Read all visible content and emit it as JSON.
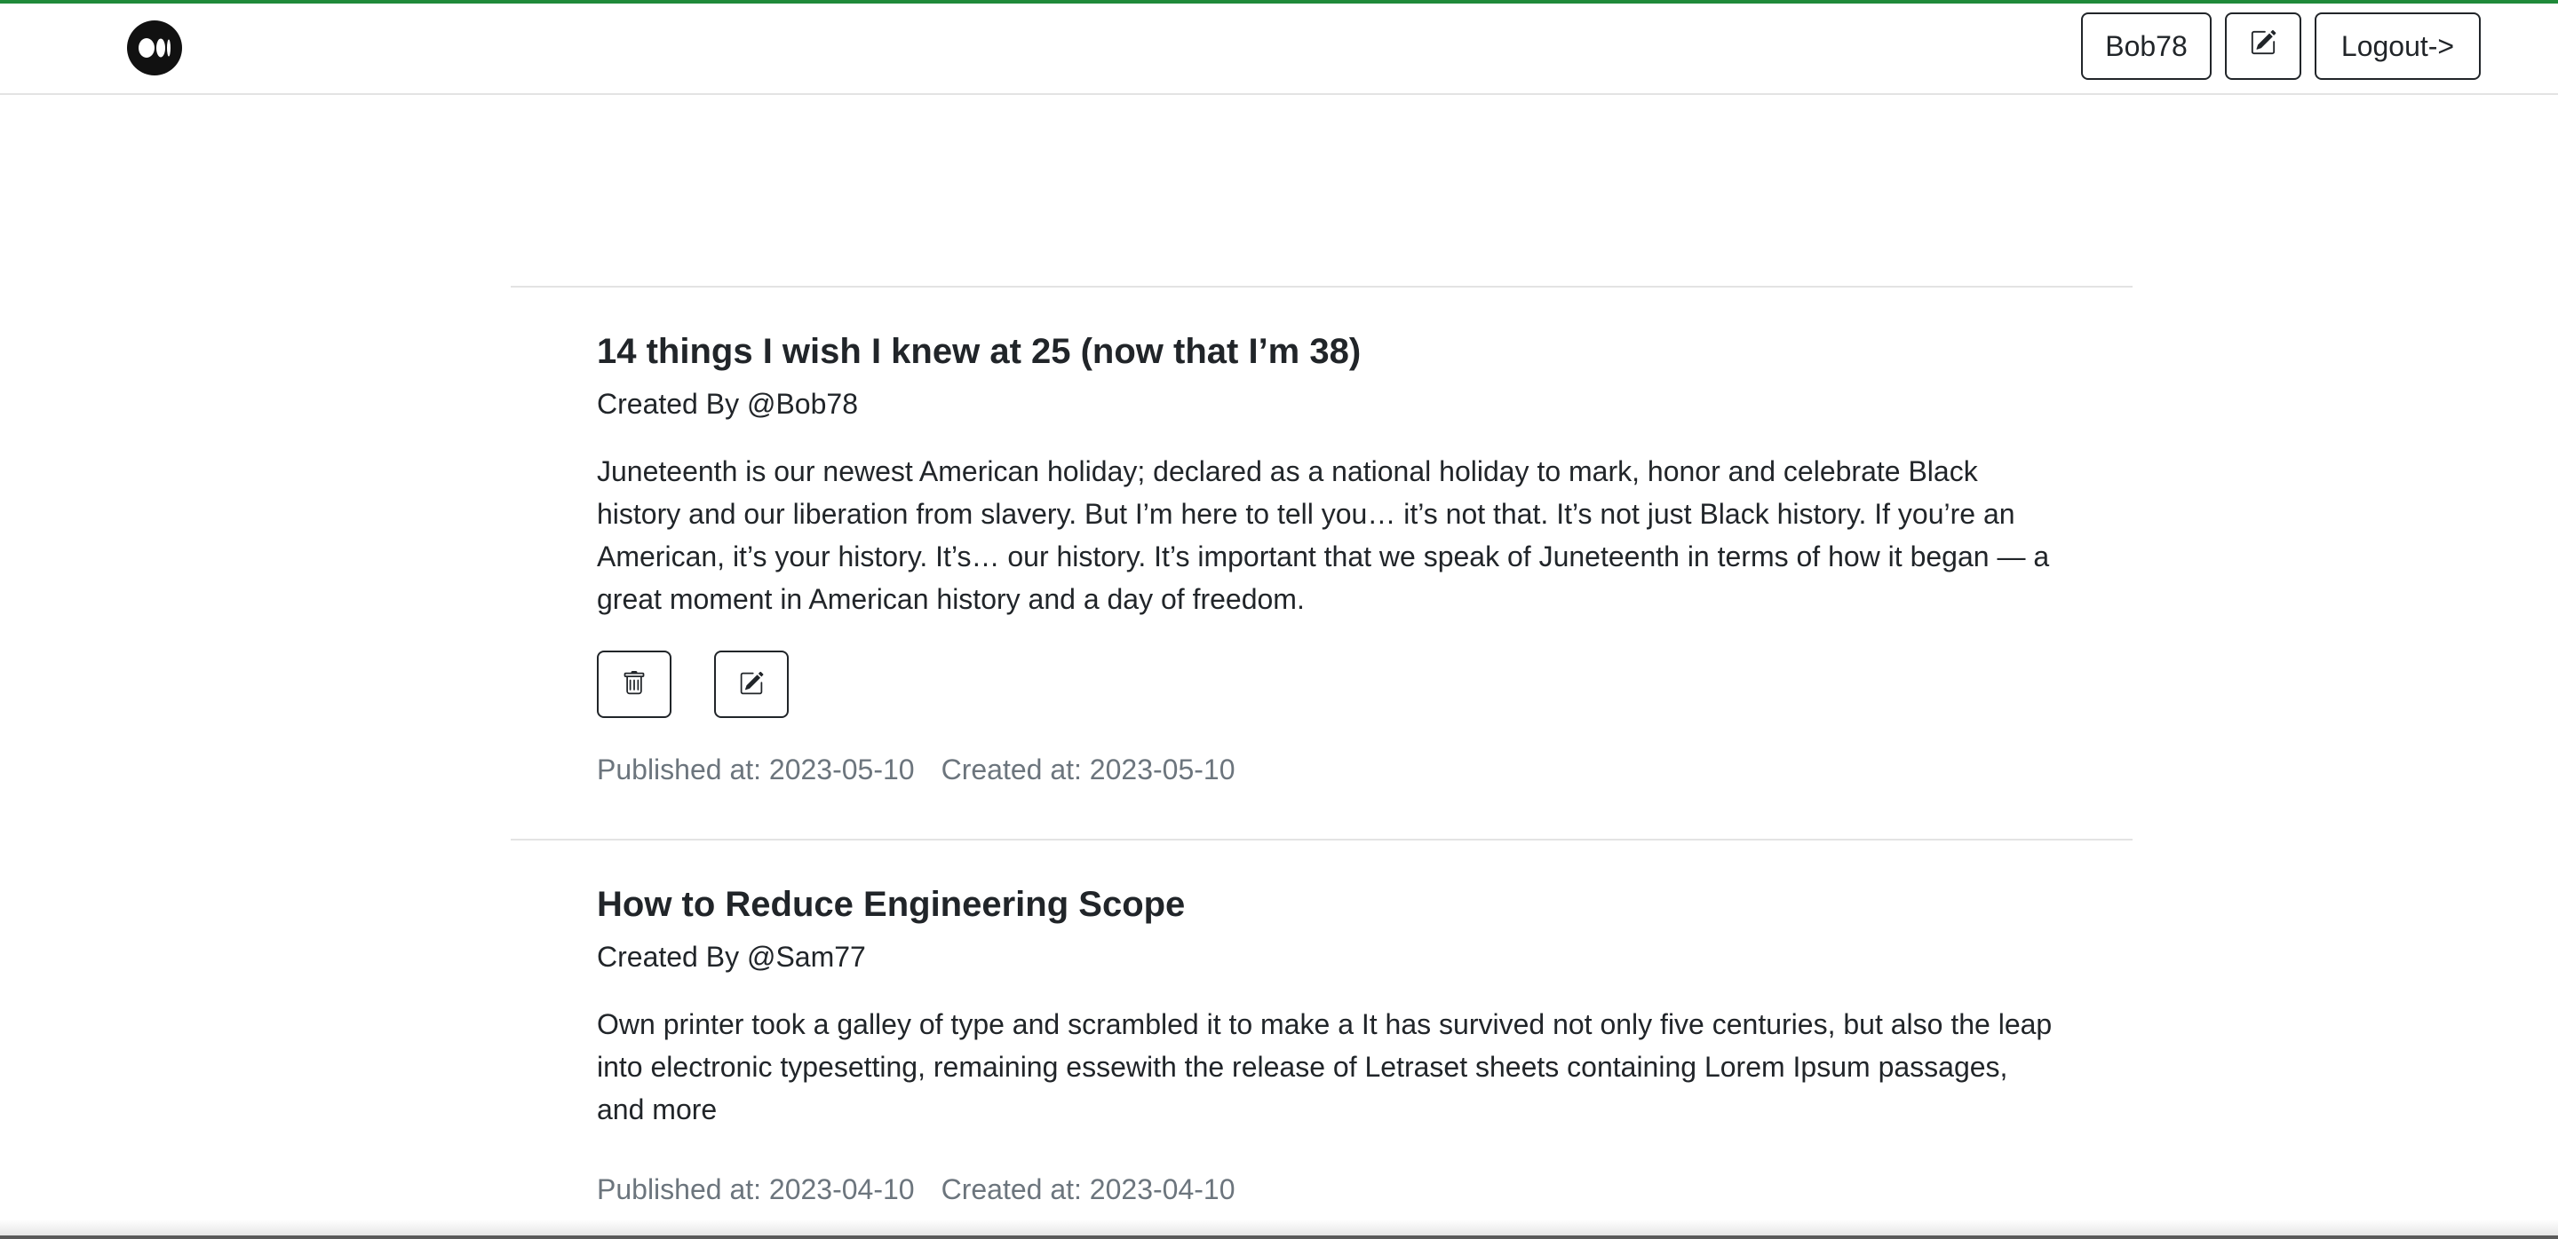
{
  "header": {
    "logo_icon": "medium-logo-icon",
    "user_label": "Bob78",
    "write_icon": "edit-square-icon",
    "logout_label": "Logout->"
  },
  "posts": [
    {
      "title": "14 things I wish I knew at 25 (now that I’m 38)",
      "author": "Created By @Bob78",
      "excerpt": "Juneteenth is our newest American holiday; declared as a national holiday to mark, honor and celebrate Black history and our liberation from slavery. But I’m here to tell you… it’s not that. It’s not just Black history. If you’re an American, it’s your history. It’s… our history. It’s important that we speak of Juneteenth in terms of how it began — a great moment in American history and a day of freedom.",
      "delete_icon": "trash-icon",
      "edit_icon": "edit-square-icon",
      "published": "Published at: 2023-05-10",
      "created": "Created at: 2023-05-10"
    },
    {
      "title": "How to Reduce Engineering Scope",
      "author": "Created By @Sam77",
      "excerpt": "Own printer took a galley of type and scrambled it to make a It has survived not only five centuries, but also the leap into electronic typesetting, remaining essewith the release of Letraset sheets containing Lorem Ipsum passages, and more",
      "published": "Published at: 2023-04-10",
      "created": "Created at: 2023-04-10"
    }
  ],
  "colors": {
    "accent_top": "#1f8a3a",
    "text": "#212529",
    "muted": "#6c757d",
    "divider": "#e3e3e3"
  }
}
